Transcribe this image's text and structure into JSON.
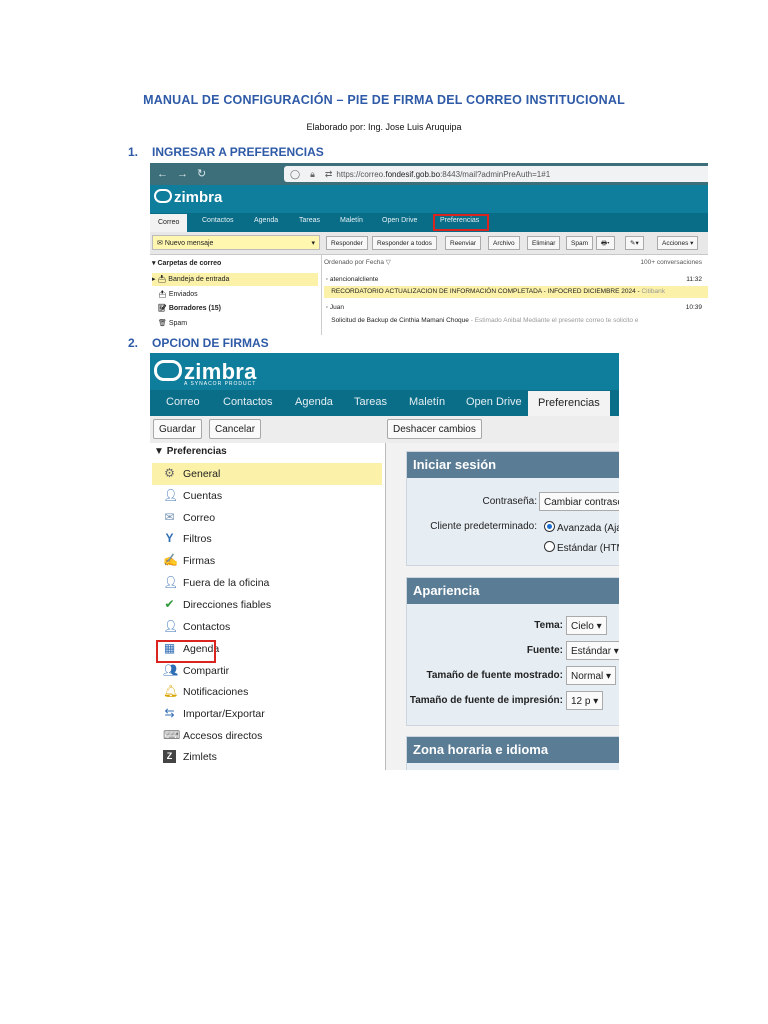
{
  "document": {
    "title": "MANUAL DE CONFIGURACIÓN – PIE DE FIRMA DEL CORREO INSTITUCIONAL",
    "author": "Elaborado por: Ing. Jose Luis Aruquipa",
    "steps": [
      {
        "number": "1.",
        "title": "INGRESAR A PREFERENCIAS"
      },
      {
        "number": "2.",
        "title": "OPCION DE FIRMAS"
      }
    ]
  },
  "shot1": {
    "url_prefix": "https://correo.",
    "url_domain": "fondesif.gob.bo",
    "url_suffix": ":8443/mail?adminPreAuth=1#1",
    "logo": "zimbra",
    "tabs": [
      "Correo",
      "Contactos",
      "Agenda",
      "Tareas",
      "Maletín",
      "Open Drive",
      "Preferencias"
    ],
    "new_message": "Nuevo mensaje",
    "toolbar": [
      "Responder",
      "Responder a todos",
      "Reenviar",
      "Archivo",
      "Eliminar",
      "Spam",
      "Acciones ▾"
    ],
    "folders_header": "Carpetas de correo",
    "folders": [
      "Bandeja de entrada",
      "Enviados",
      "Borradores (15)",
      "Spam"
    ],
    "sort_label": "Ordenado por Fecha ▽",
    "count_label": "100+ conversaciones",
    "messages": [
      {
        "from": "atencionalcliente",
        "time": "11:32",
        "subject": "RECORDATORIO ACTUALIZACION DE INFORMACIÓN COMPLETADA - INFOCRED DICIEMBRE 2024 -",
        "snippet": "Citibank"
      },
      {
        "from": "Juan",
        "time": "10:39",
        "subject": "Solicitud de Backup de Cinthia Mamani Choque",
        "snippet": "- Estimado Anibal Mediante el presente correo te solicito e"
      }
    ],
    "colors": {
      "browser": "#3d6f7a",
      "header": "#0e7e9c",
      "highlight_box": "#d9241f"
    }
  },
  "shot2": {
    "logo": "zimbra",
    "logo_sub": "A SYNACOR PRODUCT",
    "tabs": [
      "Correo",
      "Contactos",
      "Agenda",
      "Tareas",
      "Maletín",
      "Open Drive",
      "Preferencias"
    ],
    "buttons": {
      "save": "Guardar",
      "cancel": "Cancelar",
      "undo": "Deshacer cambios"
    },
    "tree_header": "Preferencias",
    "items": [
      {
        "label": "General",
        "icon": "gear-icon"
      },
      {
        "label": "Cuentas",
        "icon": "accounts-icon"
      },
      {
        "label": "Correo",
        "icon": "mail-icon"
      },
      {
        "label": "Filtros",
        "icon": "filter-icon"
      },
      {
        "label": "Firmas",
        "icon": "signature-icon"
      },
      {
        "label": "Fuera de la oficina",
        "icon": "out-of-office-icon"
      },
      {
        "label": "Direcciones fiables",
        "icon": "shield-icon"
      },
      {
        "label": "Contactos",
        "icon": "contact-icon"
      },
      {
        "label": "Agenda",
        "icon": "calendar-icon"
      },
      {
        "label": "Compartir",
        "icon": "share-icon"
      },
      {
        "label": "Notificaciones",
        "icon": "bell-icon"
      },
      {
        "label": "Importar/Exportar",
        "icon": "import-export-icon"
      },
      {
        "label": "Accesos directos",
        "icon": "shortcuts-icon"
      },
      {
        "label": "Zimlets",
        "icon": "zimlet-icon"
      }
    ],
    "login": {
      "title": "Iniciar sesión",
      "password_label": "Contraseña:",
      "password_button": "Cambiar contraseña",
      "client_label": "Cliente predeterminado:",
      "client_options": [
        "Avanzada (Ajax)",
        "Estándar (HTML)"
      ]
    },
    "appearance": {
      "title": "Apariencia",
      "theme_label": "Tema:",
      "theme_value": "Cielo ▾",
      "font_label": "Fuente:",
      "font_value": "Estándar ▾",
      "size_label": "Tamaño de fuente mostrado:",
      "size_value": "Normal ▾",
      "print_label": "Tamaño de fuente de impresión:",
      "print_value": "12 p ▾"
    },
    "tz": {
      "title": "Zona horaria e idioma"
    },
    "colors": {
      "header": "#0f7d9c",
      "panel_header": "#5a7c95",
      "selected": "#fbf1a8",
      "highlight_box": "#d9241f"
    }
  }
}
